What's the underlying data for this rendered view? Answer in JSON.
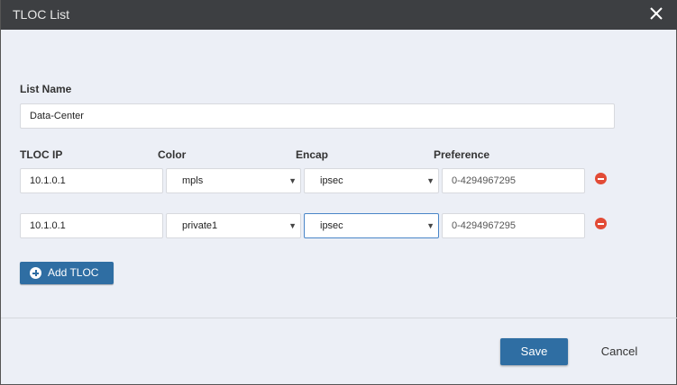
{
  "dialog": {
    "title": "TLOC List",
    "close_icon": "close-icon"
  },
  "list_name": {
    "label": "List Name",
    "value": "Data-Center"
  },
  "columns": {
    "tloc_ip": "TLOC IP",
    "color": "Color",
    "encap": "Encap",
    "preference": "Preference"
  },
  "rows": [
    {
      "tloc_ip": "10.1.0.1",
      "color": "mpls",
      "encap": "ipsec",
      "preference": "0-4294967295"
    },
    {
      "tloc_ip": "10.1.0.1",
      "color": "private1",
      "encap": "ipsec",
      "preference": "0-4294967295"
    }
  ],
  "buttons": {
    "add_tloc": "Add TLOC",
    "save": "Save",
    "cancel": "Cancel"
  },
  "colors": {
    "title_bar": "#3d3f42",
    "primary": "#2f6ea3",
    "remove": "#e24b36",
    "background": "#eceff6"
  }
}
